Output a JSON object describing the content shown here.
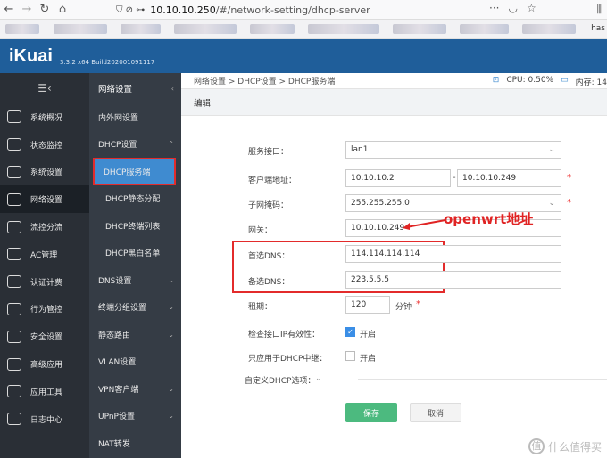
{
  "browser": {
    "url_host": "10.10.10.250",
    "url_path": "/#/network-setting/dhcp-server",
    "profile_text": "has"
  },
  "brand": {
    "logo": "iKuai",
    "version": "3.3.2 x64 Build202001091117"
  },
  "sidebar": {
    "items": [
      {
        "label": "系统概况",
        "icon": "speedometer-icon"
      },
      {
        "label": "状态监控",
        "icon": "monitor-chart-icon"
      },
      {
        "label": "系统设置",
        "icon": "gear-icon"
      },
      {
        "label": "网络设置",
        "icon": "network-icon"
      },
      {
        "label": "流控分流",
        "icon": "sliders-icon"
      },
      {
        "label": "AC管理",
        "icon": "wifi-ac-icon"
      },
      {
        "label": "认证计费",
        "icon": "id-card-icon"
      },
      {
        "label": "行为管控",
        "icon": "swap-arrows-icon"
      },
      {
        "label": "安全设置",
        "icon": "grid-shield-icon"
      },
      {
        "label": "高级应用",
        "icon": "calendar-icon"
      },
      {
        "label": "应用工具",
        "icon": "apps-icon"
      },
      {
        "label": "日志中心",
        "icon": "document-icon"
      }
    ]
  },
  "submenu": {
    "title": "网络设置",
    "items": [
      {
        "label": "内外网设置",
        "caret": ""
      },
      {
        "label": "DHCP设置",
        "caret": "^"
      },
      {
        "label": "DHCP服务端",
        "caret": "",
        "indent": true,
        "selected": true
      },
      {
        "label": "DHCP静态分配",
        "caret": "",
        "indent": true
      },
      {
        "label": "DHCP终端列表",
        "caret": "",
        "indent": true
      },
      {
        "label": "DHCP黑白名单",
        "caret": "",
        "indent": true
      },
      {
        "label": "DNS设置",
        "caret": "v"
      },
      {
        "label": "终端分组设置",
        "caret": "v"
      },
      {
        "label": "静态路由",
        "caret": "v"
      },
      {
        "label": "VLAN设置",
        "caret": ""
      },
      {
        "label": "VPN客户端",
        "caret": "v"
      },
      {
        "label": "UPnP设置",
        "caret": "v"
      },
      {
        "label": "NAT转发",
        "caret": ""
      }
    ]
  },
  "main": {
    "breadcrumb": "网络设置 > DHCP设置 > DHCP服务端",
    "cpu": "CPU: 0.50%",
    "mem": "内存: 14",
    "section_title": "编辑",
    "form": {
      "interface_label": "服务接口：",
      "interface_value": "lan1",
      "client_range_label": "客户端地址：",
      "range_start": "10.10.10.2",
      "range_dash": "-",
      "range_end": "10.10.10.249",
      "mask_label": "子网掩码：",
      "mask_value": "255.255.255.0",
      "gateway_label": "网关：",
      "gateway_value": "10.10.10.249",
      "dns1_label": "首选DNS：",
      "dns1_value": "114.114.114.114",
      "dns2_label": "备选DNS：",
      "dns2_value": "223.5.5.5",
      "lease_label": "租期：",
      "lease_value": "120",
      "lease_unit": "分钟",
      "check_if_label": "检查接口IP有效性：",
      "check_if_text": "开启",
      "check_if_on": true,
      "relay_only_label": "只应用于DHCP中继：",
      "relay_only_text": "开启",
      "relay_only_on": false,
      "custom_opts_label": "自定义DHCP选项：",
      "save": "保存",
      "cancel": "取消",
      "required_mark": "*"
    },
    "annotation": "openwrt地址"
  },
  "watermark": {
    "glyph": "值",
    "text": "什么值得买"
  },
  "colors": {
    "brand": "#1f5e9a",
    "sidebar": "#2a2f36",
    "submenu": "#353c45",
    "accent": "#3f8bd0",
    "save": "#4cba7f",
    "highlight": "#e32b2b"
  }
}
